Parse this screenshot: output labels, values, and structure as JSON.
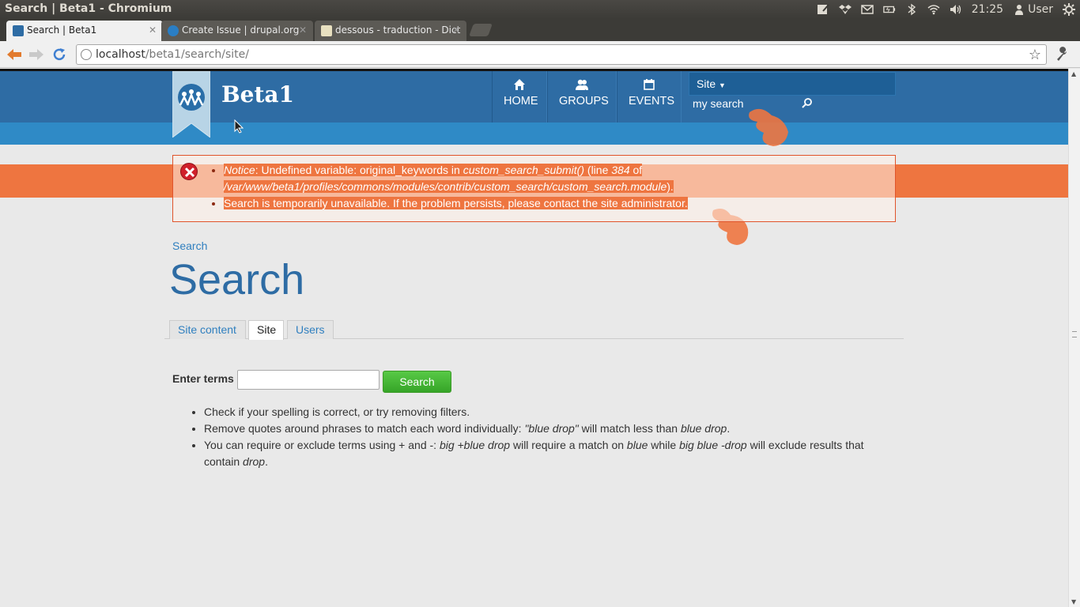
{
  "os": {
    "window_title": "Search | Beta1 - Chromium",
    "clock": "21:25",
    "user": "User"
  },
  "browser": {
    "tabs": [
      {
        "title": "Search | Beta1",
        "active": true
      },
      {
        "title": "Create Issue | drupal.org",
        "active": false
      },
      {
        "title": "dessous - traduction - Dict",
        "active": false
      }
    ],
    "url_host": "localhost",
    "url_path": "/beta1/search/site/"
  },
  "site": {
    "name": "Beta1",
    "nav": [
      {
        "label": "HOME",
        "icon": "home-icon"
      },
      {
        "label": "GROUPS",
        "icon": "groups-icon"
      },
      {
        "label": "EVENTS",
        "icon": "calendar-icon"
      }
    ],
    "search_scope": "Site",
    "search_value": "my search"
  },
  "errors": {
    "notice_prefix": "Notice",
    "notice_text": ": Undefined variable: original_keywords in ",
    "notice_func": "custom_search_submit()",
    "notice_line_pre": " (line ",
    "notice_line_num": "384",
    "notice_line_post": " of",
    "notice_path": "/var/www/beta1/profiles/commons/modules/contrib/custom_search/custom_search.module",
    "notice_end": ").",
    "unavailable": "Search is temporarily unavailable. If the problem persists, please contact the site administrator."
  },
  "content": {
    "breadcrumb": "Search",
    "title": "Search",
    "tabs": [
      "Site content",
      "Site",
      "Users"
    ],
    "active_tab": "Site",
    "form_label": "Enter terms",
    "search_button": "Search",
    "tips": {
      "t1": "Check if your spelling is correct, or try removing filters.",
      "t2a": "Remove quotes around phrases to match each word individually: ",
      "t2b": "\"blue drop\"",
      "t2c": " will match less than ",
      "t2d": "blue drop",
      "t2e": ".",
      "t3a": "You can require or exclude terms using + and -: ",
      "t3b": "big +blue drop",
      "t3c": " will require a match on ",
      "t3d": "blue",
      "t3e": " while ",
      "t3f": "big blue -drop",
      "t3g": " will exclude results that contain ",
      "t3h": "drop",
      "t3i": "."
    }
  },
  "colors": {
    "header": "#2e6ca4",
    "subbar": "#2f8ac6",
    "error_orange": "#ee7540",
    "search_button": "#3fb02f"
  }
}
